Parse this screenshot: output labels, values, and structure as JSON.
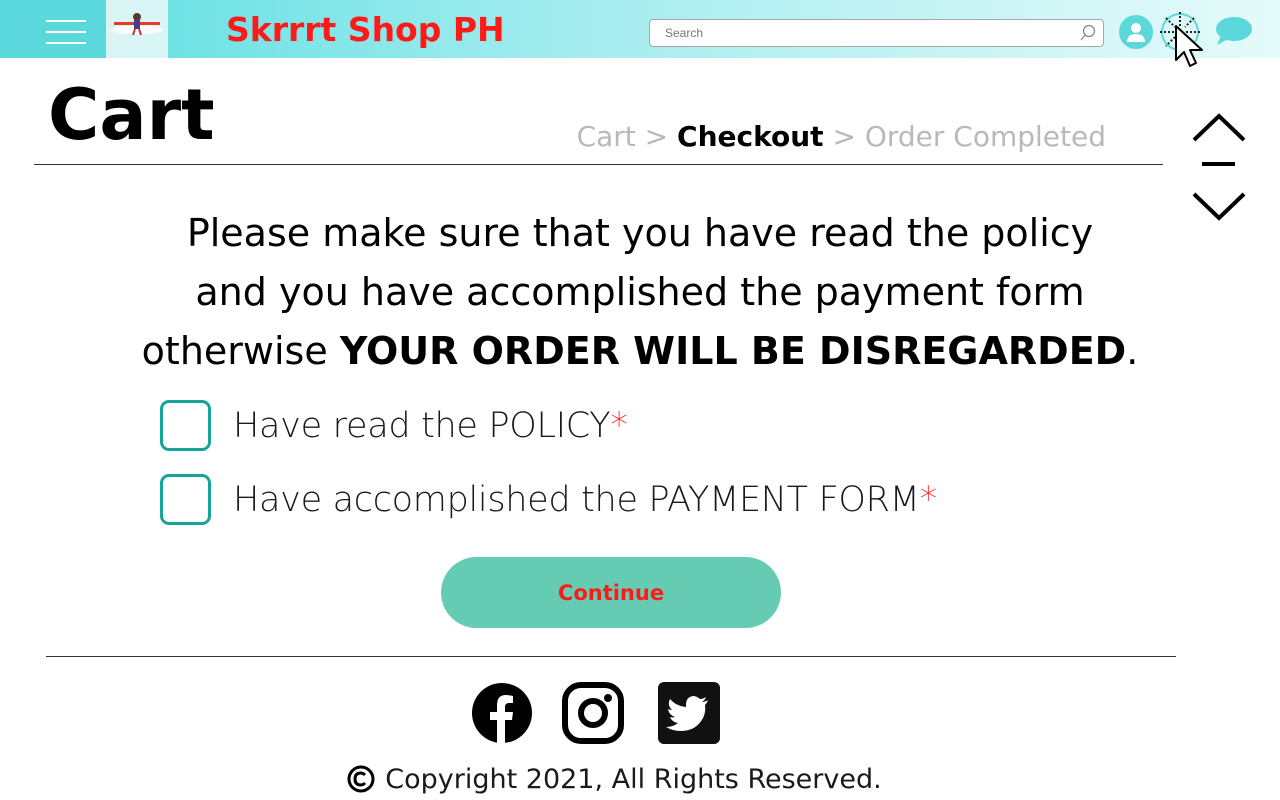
{
  "header": {
    "site_title": "Skrrrt Shop PH",
    "search_placeholder": "Search",
    "icons": [
      "menu-icon",
      "logo",
      "search-icon",
      "user-icon",
      "loading-icon",
      "cursor-icon",
      "chat-icon"
    ]
  },
  "page": {
    "title": "Cart",
    "breadcrumb": {
      "step1": "Cart",
      "sep1": " > ",
      "step2": "Checkout",
      "sep2": " > ",
      "step3": "Order Completed"
    }
  },
  "notice": {
    "line1": "Please make sure that you have read the policy",
    "line2": "and you have accomplished the payment form",
    "line3_prefix": "otherwise ",
    "line3_bold": "YOUR ORDER WILL BE DISREGARDED",
    "line3_suffix": "."
  },
  "checklist": [
    {
      "label": "Have read the POLICY",
      "required_mark": "*",
      "checked": false
    },
    {
      "label": "Have accomplished the PAYMENT FORM",
      "required_mark": "*",
      "checked": false
    }
  ],
  "actions": {
    "continue_label": "Continue"
  },
  "footer": {
    "social": [
      "facebook-icon",
      "instagram-icon",
      "twitter-icon"
    ],
    "copyright": "Copyright 2021, All Rights Reserved."
  },
  "colors": {
    "header_start": "#58dde0",
    "brand_red": "#ff1a1a",
    "checkbox_border": "#16a39a",
    "button_bg": "#66cbb3",
    "icon_teal": "#5ad8dc"
  }
}
